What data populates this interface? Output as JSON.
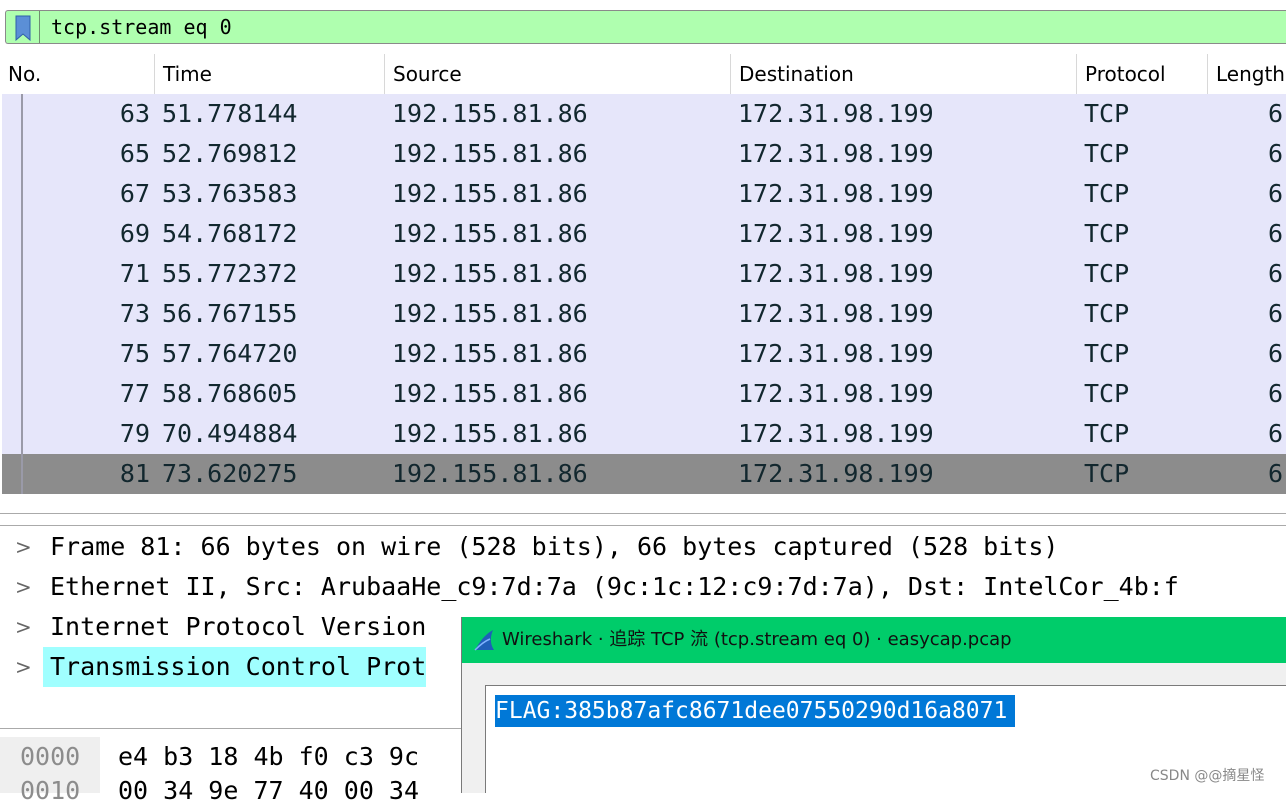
{
  "filter": {
    "text": "tcp.stream eq 0"
  },
  "columns": [
    "No.",
    "Time",
    "Source",
    "Destination",
    "Protocol",
    "Length"
  ],
  "packets": [
    {
      "no": "63",
      "time": "51.778144",
      "src": "192.155.81.86",
      "dst": "172.31.98.199",
      "proto": "TCP",
      "len": "6"
    },
    {
      "no": "65",
      "time": "52.769812",
      "src": "192.155.81.86",
      "dst": "172.31.98.199",
      "proto": "TCP",
      "len": "6"
    },
    {
      "no": "67",
      "time": "53.763583",
      "src": "192.155.81.86",
      "dst": "172.31.98.199",
      "proto": "TCP",
      "len": "6"
    },
    {
      "no": "69",
      "time": "54.768172",
      "src": "192.155.81.86",
      "dst": "172.31.98.199",
      "proto": "TCP",
      "len": "6"
    },
    {
      "no": "71",
      "time": "55.772372",
      "src": "192.155.81.86",
      "dst": "172.31.98.199",
      "proto": "TCP",
      "len": "6"
    },
    {
      "no": "73",
      "time": "56.767155",
      "src": "192.155.81.86",
      "dst": "172.31.98.199",
      "proto": "TCP",
      "len": "6"
    },
    {
      "no": "75",
      "time": "57.764720",
      "src": "192.155.81.86",
      "dst": "172.31.98.199",
      "proto": "TCP",
      "len": "6"
    },
    {
      "no": "77",
      "time": "58.768605",
      "src": "192.155.81.86",
      "dst": "172.31.98.199",
      "proto": "TCP",
      "len": "6"
    },
    {
      "no": "79",
      "time": "70.494884",
      "src": "192.155.81.86",
      "dst": "172.31.98.199",
      "proto": "TCP",
      "len": "6"
    },
    {
      "no": "81",
      "time": "73.620275",
      "src": "192.155.81.86",
      "dst": "172.31.98.199",
      "proto": "TCP",
      "len": "6"
    }
  ],
  "details": [
    "Frame 81: 66 bytes on wire (528 bits), 66 bytes captured (528 bits)",
    "Ethernet II, Src: ArubaaHe_c9:7d:7a (9c:1c:12:c9:7d:7a), Dst: IntelCor_4b:f",
    "Internet Protocol Version",
    "Transmission Control Prot"
  ],
  "bytes": [
    {
      "offset": "0000",
      "hex": "e4 b3 18 4b f0 c3 9c"
    },
    {
      "offset": "0010",
      "hex": "00 34 9e 77 40 00 34"
    }
  ],
  "dialog": {
    "title": "Wireshark · 追踪 TCP 流 (tcp.stream eq 0) · easycap.pcap",
    "content": "FLAG:385b87afc8671dee07550290d16a8071"
  },
  "watermark": "CSDN @@摘星怪",
  "colors": {
    "filter_bg": "#afffaf",
    "row_bg": "#e6e6fa",
    "selected_row_bg": "#8c8c8c",
    "detail_highlight": "#a0ffff",
    "dialog_title_bg": "#00cc6a",
    "selection_bg": "#0078d7"
  }
}
